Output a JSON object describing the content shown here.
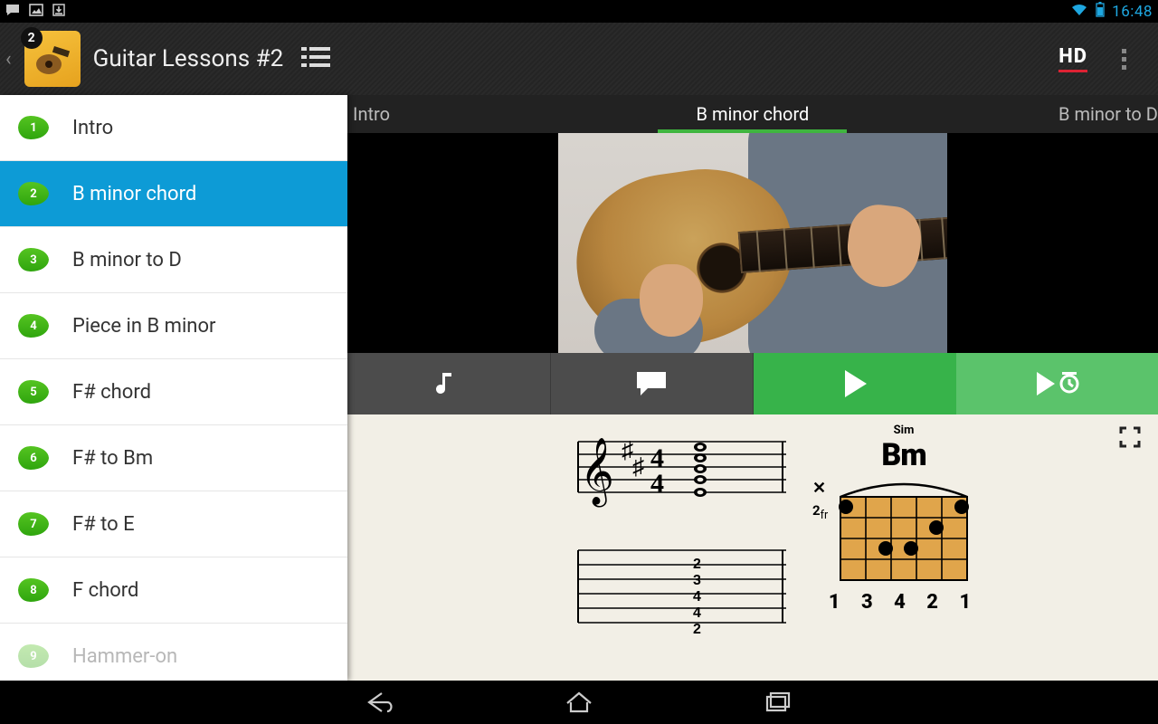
{
  "status": {
    "time": "16:48"
  },
  "appbar": {
    "title": "Guitar Lessons #2",
    "icon_badge": "2",
    "hd_label": "HD"
  },
  "sidebar": {
    "items": [
      {
        "num": "1",
        "label": "Intro"
      },
      {
        "num": "2",
        "label": "B minor chord"
      },
      {
        "num": "3",
        "label": "B minor to D"
      },
      {
        "num": "4",
        "label": "Piece in B minor"
      },
      {
        "num": "5",
        "label": "F# chord"
      },
      {
        "num": "6",
        "label": "F# to Bm"
      },
      {
        "num": "7",
        "label": "F# to E"
      },
      {
        "num": "8",
        "label": "F chord"
      },
      {
        "num": "9",
        "label": "Hammer-on"
      }
    ],
    "selected_index": 1
  },
  "tabs": {
    "prev": "Intro",
    "current": "B minor chord",
    "next": "B minor to D"
  },
  "chord": {
    "sup": "Sim",
    "name": "Bm",
    "fret_label": "2",
    "fret_suffix": "fr",
    "fingers": "1 3 4 2 1",
    "tab_numbers": [
      "2",
      "3",
      "4",
      "4",
      "2"
    ]
  }
}
